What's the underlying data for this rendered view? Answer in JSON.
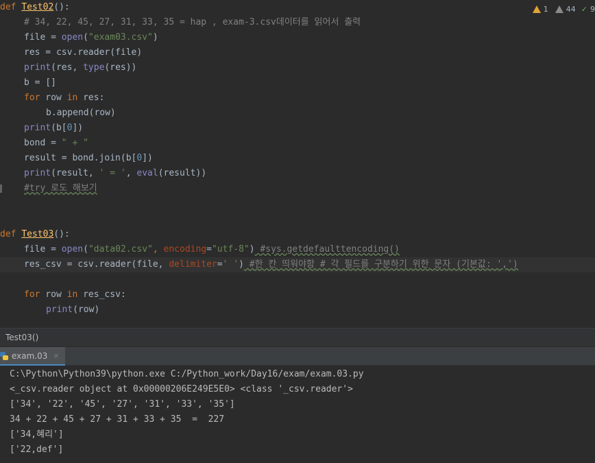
{
  "inspections": {
    "warnings": "1",
    "weak_warnings": "44",
    "typos": "9"
  },
  "code": {
    "l1": {
      "kw": "def",
      "name": "Test02",
      "rest": "():"
    },
    "l2": "# 34, 22, 45, 27, 31, 33, 35 = hap , exam-3.csv데이터를 읽어서 출력",
    "l3": {
      "a": "file = ",
      "b": "open",
      "c": "(",
      "d": "\"exam03.csv\"",
      "e": ")"
    },
    "l4": {
      "a": "res = csv.reader(file)"
    },
    "l5": {
      "a": "print",
      "b": "(res, ",
      "c": "type",
      "d": "(res))"
    },
    "l6": {
      "a": "b = []"
    },
    "l7": {
      "a": "for",
      "b": " row ",
      "c": "in",
      "d": " res:"
    },
    "l8": {
      "a": "b.append(row)"
    },
    "l9": {
      "a": "print",
      "b": "(b[",
      "c": "0",
      "d": "])"
    },
    "l10": {
      "a": "bond = ",
      "b": "\" + \""
    },
    "l11": {
      "a": "result = bond.join(b[",
      "b": "0",
      "c": "])"
    },
    "l12": {
      "a": "print",
      "b": "(result, ",
      "c": "' = '",
      "d": ", ",
      "e": "eval",
      "f": "(result))"
    },
    "l13": "#try 로도 해보기",
    "l14": {
      "kw": "def",
      "name": "Test03",
      "rest": "():"
    },
    "l15": {
      "a": "file = ",
      "b": "open",
      "c": "(",
      "d": "\"data02.csv\"",
      "e": ", ",
      "f": "encoding",
      "g": "=",
      "h": "\"utf-8\"",
      "i": ")",
      "j": " #sys.getdefaulttencoding()"
    },
    "l16": {
      "a": "res_csv = csv.reader(file, ",
      "b": "delimiter",
      "c": "=",
      "d": "' '",
      "e": ")",
      "f": " #한 칸 띄워야함 # 각 필드를 구분하기 위한 문자 (기본값: ',')"
    },
    "l17": {
      "a": "for",
      "b": " row ",
      "c": "in",
      "d": " res_csv:"
    },
    "l18": {
      "a": "print",
      "b": "(row)"
    }
  },
  "breadcrumb": "Test03()",
  "run_tab": {
    "label": "exam.03",
    "close": "×"
  },
  "console": [
    "C:\\Python\\Python39\\python.exe C:/Python_work/Day16/exam/exam.03.py",
    "<_csv.reader object at 0x00000206E249E5E0> <class '_csv.reader'>",
    "['34', '22', '45', '27', '31', '33', '35']",
    "34 + 22 + 45 + 27 + 31 + 33 + 35  =  227",
    "['34,혜리']",
    "['22,def']"
  ]
}
